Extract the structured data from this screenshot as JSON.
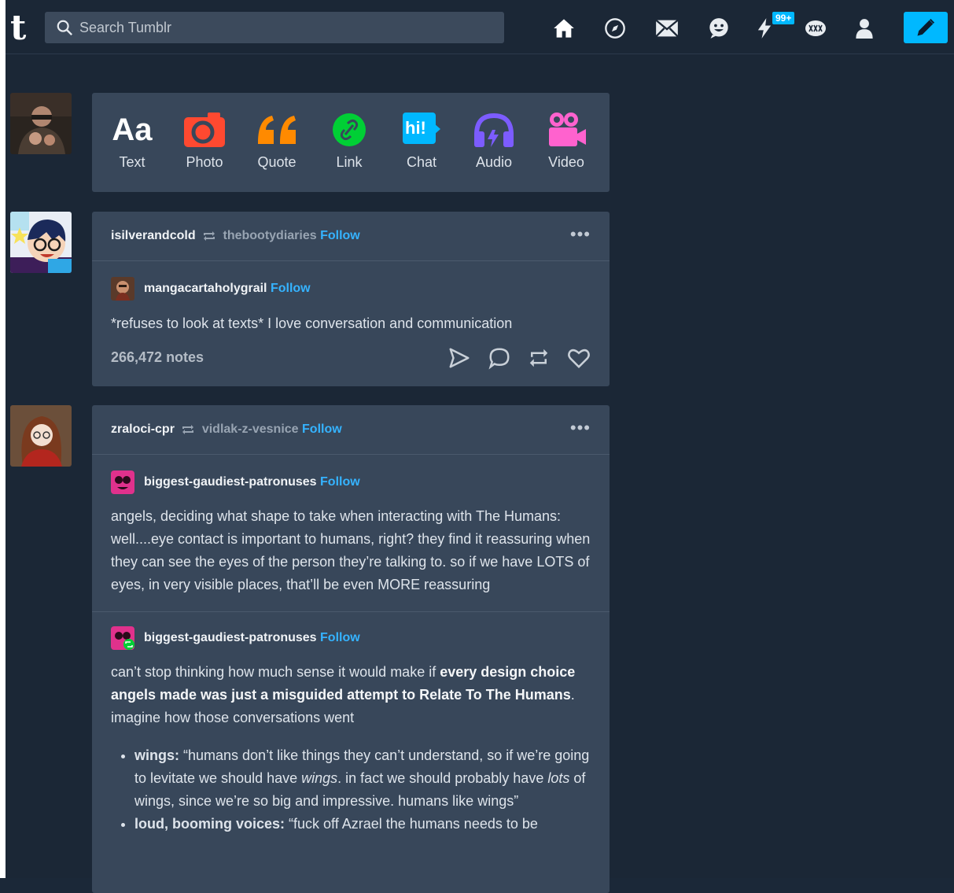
{
  "header": {
    "logo": "t",
    "search_placeholder": "Search Tumblr",
    "activity_badge": "99+",
    "colors": {
      "accent": "#00b8ff",
      "bg": "#1b2736",
      "card": "#38475a"
    }
  },
  "composer": {
    "types": [
      {
        "label": "Text"
      },
      {
        "label": "Photo"
      },
      {
        "label": "Quote"
      },
      {
        "label": "Link"
      },
      {
        "label": "Chat"
      },
      {
        "label": "Audio"
      },
      {
        "label": "Video"
      }
    ],
    "aa": "Aa",
    "chat_glyph": "hi!"
  },
  "posts": [
    {
      "blog": "isilverandcold",
      "reblogged_from": "thebootydiaries",
      "follow": "Follow",
      "more": "•••",
      "content_blog": "mangacartaholygrail",
      "content_follow": "Follow",
      "text": "*refuses to look at texts* I love conversation and communication",
      "notes": "266,472 notes"
    },
    {
      "blog": "zraloci-cpr",
      "reblogged_from": "vidlak-z-vesnice",
      "follow": "Follow",
      "more": "•••",
      "first": {
        "blog": "biggest-gaudiest-patronuses",
        "follow": "Follow",
        "text": "angels, deciding what shape to take when interacting with The Humans: well....eye contact is important to humans, right? they find it reassuring when they can see the eyes of the person they’re talking to. so if we have LOTS of eyes, in very visible places, that’ll be even MORE reassuring"
      },
      "second": {
        "blog": "biggest-gaudiest-patronuses",
        "follow": "Follow",
        "intro": "can’t stop thinking how much sense it would make if ",
        "bold": "every design choice angels made was just a misguided attempt to Relate To The Humans",
        "outro": ". imagine how those conversations went",
        "bullet1_term": "wings:",
        "bullet1_a": " “humans don’t like things they can’t understand, so if we’re going to levitate we should have ",
        "bullet1_em1": "wings",
        "bullet1_b": ". in fact we should probably have ",
        "bullet1_em2": "lots",
        "bullet1_c": " of wings, since we’re so big and impressive. humans like wings”",
        "bullet2_term": "loud, booming voices:",
        "bullet2_text": " “fuck off Azrael the humans needs to be"
      }
    }
  ]
}
